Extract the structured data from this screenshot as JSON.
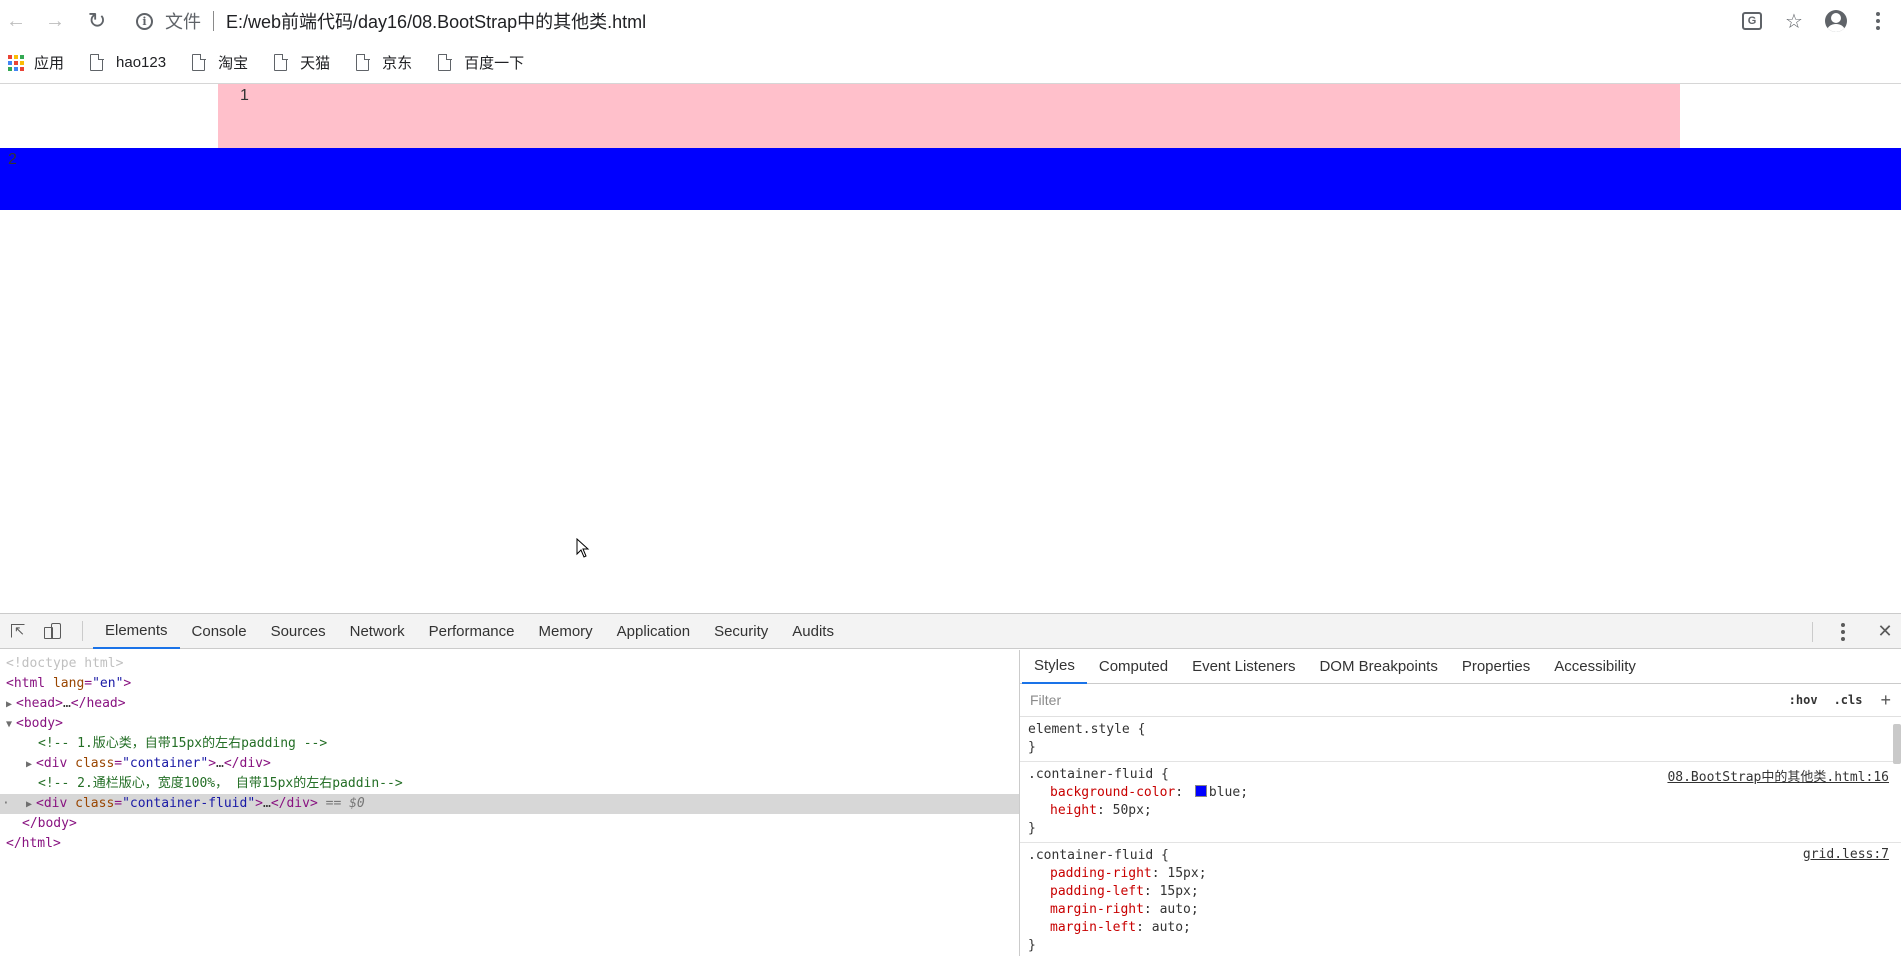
{
  "browser": {
    "nav": {
      "back_icon": "←",
      "forward_icon": "→",
      "reload_icon": "↻"
    },
    "address": {
      "scheme_label": "文件",
      "url": "E:/web前端代码/day16/08.BootStrap中的其他类.html"
    },
    "icons": [
      "translate-icon",
      "star-icon",
      "account-icon",
      "menu-icon"
    ],
    "bookmarks": [
      {
        "label": "应用",
        "icon": "apps-icon"
      },
      {
        "label": "hao123",
        "icon": "page-icon"
      },
      {
        "label": "淘宝",
        "icon": "page-icon"
      },
      {
        "label": "天猫",
        "icon": "page-icon"
      },
      {
        "label": "京东",
        "icon": "page-icon"
      },
      {
        "label": "百度一下",
        "icon": "page-icon"
      }
    ]
  },
  "page": {
    "container_text": "1",
    "container_fluid_text": "2",
    "colors": {
      "container_bg": "#ffc0cb",
      "fluid_bg": "#0000ff"
    }
  },
  "devtools": {
    "tabs": [
      "Elements",
      "Console",
      "Sources",
      "Network",
      "Performance",
      "Memory",
      "Application",
      "Security",
      "Audits"
    ],
    "active_tab": "Elements",
    "dom": {
      "doctype": "<!doctype html>",
      "html_open_tag": "html",
      "html_lang_attr": "lang",
      "html_lang_val": "\"en\"",
      "head_tag": "head",
      "body_tag": "body",
      "comment1": "<!-- 1.版心类，自带15px的左右padding -->",
      "div1_tag": "div",
      "div1_attr": "class",
      "div1_val": "\"container\"",
      "comment2": "<!-- 2.通栏版心，宽度100%， 自带15px的左右paddin-->",
      "div2_tag": "div",
      "div2_attr": "class",
      "div2_val": "\"container-fluid\"",
      "selected_marker": "== $0",
      "body_close": "</body>",
      "html_close": "</html>",
      "ellipsis": "…"
    },
    "styles": {
      "tabs": [
        "Styles",
        "Computed",
        "Event Listeners",
        "DOM Breakpoints",
        "Properties",
        "Accessibility"
      ],
      "active_tab": "Styles",
      "filter_placeholder": "Filter",
      "hov": ":hov",
      "cls": ".cls",
      "element_style": "element.style {",
      "close_brace": "}",
      "rule1": {
        "selector": ".container-fluid {",
        "source": "08.BootStrap中的其他类.html:16",
        "props": [
          {
            "name": "background-color",
            "value": "blue;",
            "swatch": "#0000ff"
          },
          {
            "name": "height",
            "value": "50px;"
          }
        ]
      },
      "rule2": {
        "selector": ".container-fluid {",
        "source": "grid.less:7",
        "props": [
          {
            "name": "padding-right",
            "value": "15px;"
          },
          {
            "name": "padding-left",
            "value": "15px;"
          },
          {
            "name": "margin-right",
            "value": "auto;"
          },
          {
            "name": "margin-left",
            "value": "auto;"
          }
        ]
      }
    }
  }
}
